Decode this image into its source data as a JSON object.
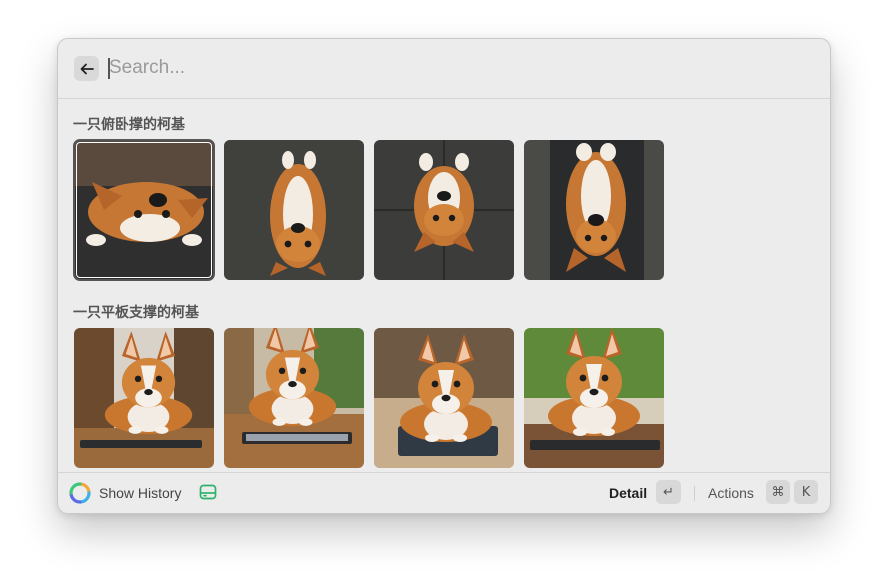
{
  "search": {
    "placeholder": "Search..."
  },
  "sections": [
    {
      "title": "一只俯卧撑的柯基"
    },
    {
      "title": "一只平板支撑的柯基"
    }
  ],
  "footer": {
    "history_label": "Show History",
    "detail_label": "Detail",
    "enter_key": "↵",
    "actions_label": "Actions",
    "cmd_key": "⌘",
    "k_key": "K"
  },
  "colors": {
    "window_bg": "#ececec",
    "accent_green": "#2fb36a"
  },
  "icons": [
    "back-arrow-icon",
    "app-logo-icon",
    "tray-icon"
  ]
}
